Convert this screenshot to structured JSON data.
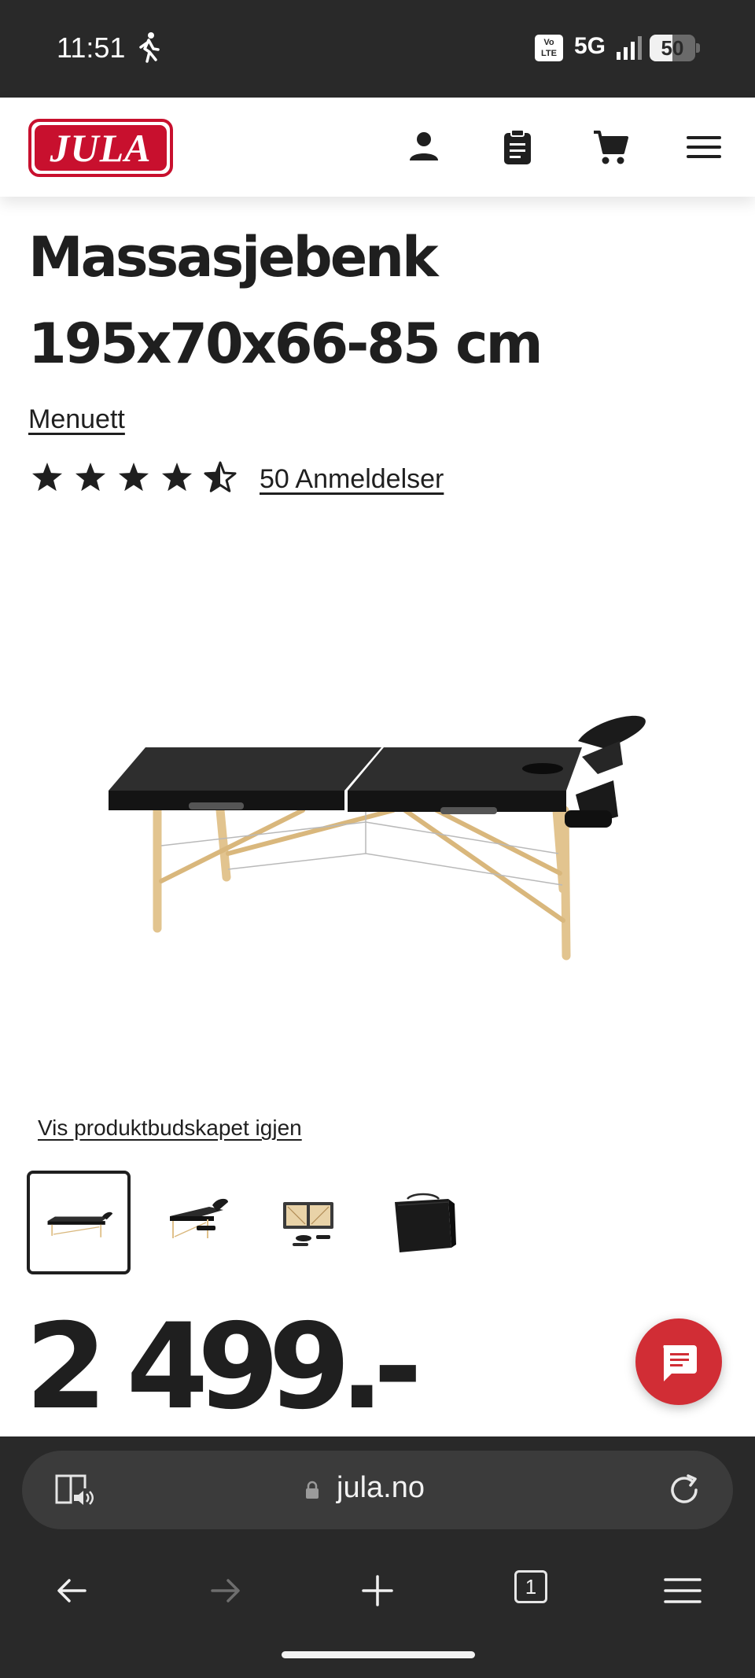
{
  "status_bar": {
    "time": "11:51",
    "network_badge": "Vo LTE",
    "network": "5G",
    "battery": "50",
    "battery_level": 0.5,
    "icons": [
      "walk-icon",
      "volte-icon",
      "signal-icon",
      "battery-icon"
    ]
  },
  "header": {
    "logo_text": "JULA",
    "icons": [
      "account-icon",
      "shopping-list-icon",
      "cart-icon",
      "menu-icon"
    ],
    "brand_color": "#c8102e"
  },
  "product": {
    "title": "Massasjebenk 195x70x66-85 cm",
    "brand": "Menuett",
    "rating_stars": 4.5,
    "rating_max": 5,
    "reviews": "50 Anmeldelser",
    "restore_offer_link": "Vis produktbudskapet igjen",
    "thumbnails": [
      "massage-table-side",
      "massage-table-angle",
      "massage-table-folded",
      "carry-bag"
    ],
    "price": "2 499.-"
  },
  "chat": {
    "icon": "chat-icon",
    "color": "#d12d35"
  },
  "browser": {
    "url": "jula.no",
    "tab_count": "1",
    "icons": [
      "reader-mode-icon",
      "lock-icon",
      "reload-icon",
      "back-icon",
      "forward-icon",
      "new-tab-icon",
      "tabs-icon",
      "browser-menu-icon"
    ]
  }
}
